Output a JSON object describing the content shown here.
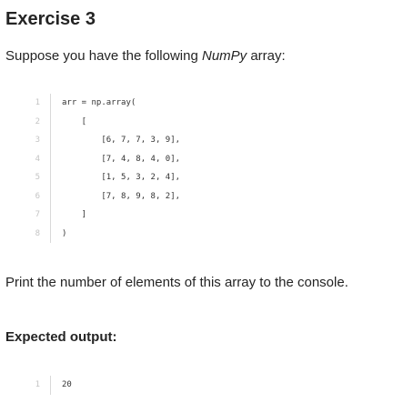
{
  "exercise": {
    "title": "Exercise 3",
    "intro_prefix": "Suppose you have the following ",
    "intro_em": "NumPy",
    "intro_suffix": " array:",
    "code_lines": [
      {
        "num": "1",
        "text": "arr = np.array("
      },
      {
        "num": "2",
        "text": "    ["
      },
      {
        "num": "3",
        "text": "        [6, 7, 7, 3, 9],"
      },
      {
        "num": "4",
        "text": "        [7, 4, 8, 4, 0],"
      },
      {
        "num": "5",
        "text": "        [1, 5, 3, 2, 4],"
      },
      {
        "num": "6",
        "text": "        [7, 8, 9, 8, 2],"
      },
      {
        "num": "7",
        "text": "    ]"
      },
      {
        "num": "8",
        "text": ")"
      }
    ],
    "instruction": "Print the number of elements of this array to the console.",
    "expected_label": "Expected output:",
    "output_lines": [
      {
        "num": "1",
        "text": "20"
      }
    ]
  }
}
